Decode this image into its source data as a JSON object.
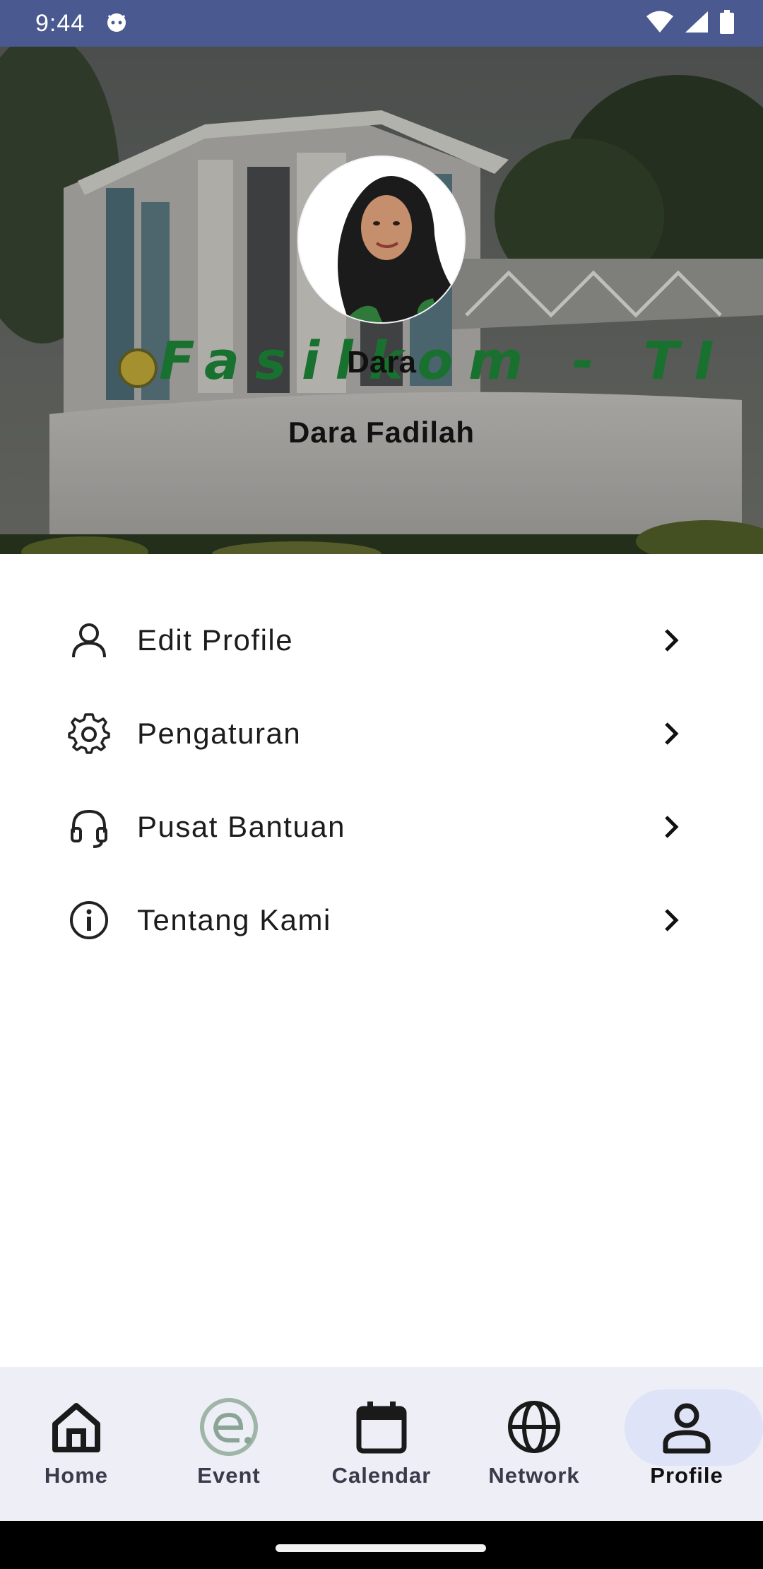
{
  "status_bar": {
    "time": "9:44",
    "icons": [
      "android-face-icon",
      "wifi-icon",
      "cellular-signal-icon",
      "battery-icon"
    ]
  },
  "profile": {
    "name": "Dara",
    "full_name": "Dara Fadilah",
    "header_sign_text": "Fasilkom - TI"
  },
  "menu": {
    "items": [
      {
        "label": "Edit Profile",
        "icon": "person-outline-icon"
      },
      {
        "label": "Pengaturan",
        "icon": "gear-icon"
      },
      {
        "label": "Pusat Bantuan",
        "icon": "headset-icon"
      },
      {
        "label": "Tentang Kami",
        "icon": "info-icon"
      }
    ]
  },
  "bottom_nav": {
    "items": [
      {
        "label": "Home",
        "icon": "home-icon",
        "active": false
      },
      {
        "label": "Event",
        "icon": "event-logo-icon",
        "active": false
      },
      {
        "label": "Calendar",
        "icon": "calendar-icon",
        "active": false
      },
      {
        "label": "Network",
        "icon": "globe-icon",
        "active": false
      },
      {
        "label": "Profile",
        "icon": "person-icon",
        "active": true
      }
    ]
  },
  "colors": {
    "status_bar": "#4a5a91",
    "nav_background": "#eeeef7",
    "nav_active_pill": "#dfe3f7",
    "sign_text_green": "#1f8a3a"
  }
}
